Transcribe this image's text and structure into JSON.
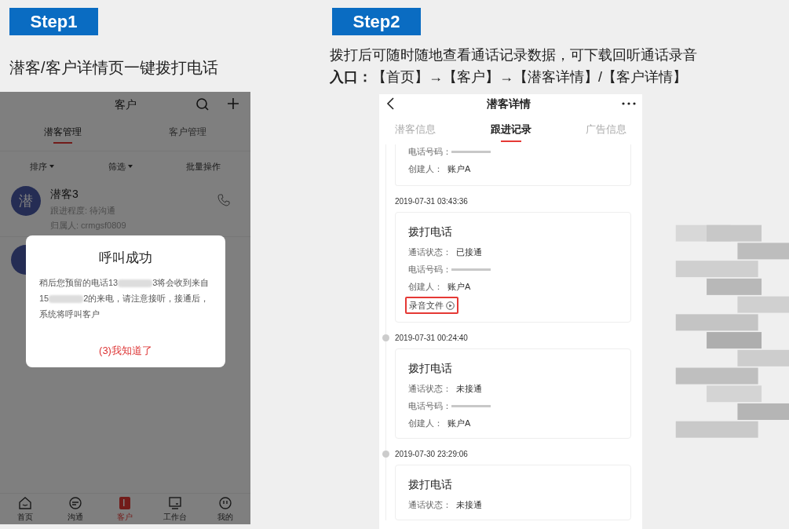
{
  "step1": {
    "badge": "Step1",
    "caption": "潜客/客户详情页一键拨打电话"
  },
  "step2": {
    "badge": "Step2",
    "caption": "拨打后可随时随地查看通话记录数据，可下载回听通话录音",
    "entry": "**入口：**【首页】→【客户】→【潜客详情】/【客户详情】"
  },
  "customer_screen": {
    "title": "客户",
    "tabs": [
      {
        "label": "潜客管理",
        "selected": true
      },
      {
        "label": "客户管理",
        "selected": false
      }
    ],
    "toolbar": [
      {
        "label": "排序",
        "dropdown": true
      },
      {
        "label": "筛选",
        "dropdown": true
      },
      {
        "label": "批量操作",
        "dropdown": false
      }
    ],
    "items": [
      {
        "avatar": "潜",
        "name": "潜客3",
        "lines": [
          "跟进程度: 待沟通",
          "归属人: crmgsf0809"
        ]
      }
    ],
    "dialog": {
      "title": "呼叫成功",
      "message": [
        "稍后您预留的电话13",
        "3将会收到来自15",
        "2的来电，请注意接听，接通后，系统将呼叫客户"
      ],
      "button": "(3)我知道了"
    },
    "nav": [
      {
        "label": "首页",
        "selected": false
      },
      {
        "label": "沟通",
        "selected": false
      },
      {
        "label": "客户",
        "selected": true
      },
      {
        "label": "工作台",
        "selected": false
      },
      {
        "label": "我的",
        "selected": false
      }
    ]
  },
  "detail_screen": {
    "title": "潜客详情",
    "tabs": [
      {
        "label": "潜客信息",
        "selected": false
      },
      {
        "label": "跟进记录",
        "selected": true
      },
      {
        "label": "广告信息",
        "selected": false
      }
    ],
    "records": [
      {
        "fields": [
          {
            "label": "电话号码："
          },
          {
            "label": "创建人：",
            "value": "账户A"
          }
        ]
      },
      {
        "timestamp": "2019-07-31 03:43:36",
        "dot": false,
        "title": "拨打电话",
        "fields": [
          {
            "label": "通话状态：",
            "value": "已接通"
          },
          {
            "label": "电话号码："
          },
          {
            "label": "创建人：",
            "value": "账户A"
          }
        ],
        "recording": "录音文件"
      },
      {
        "timestamp": "2019-07-31 00:24:40",
        "dot": true,
        "title": "拨打电话",
        "fields": [
          {
            "label": "通话状态：",
            "value": "未接通"
          },
          {
            "label": "电话号码："
          },
          {
            "label": "创建人：",
            "value": "账户A"
          }
        ]
      },
      {
        "timestamp": "2019-07-30 23:29:06",
        "dot": true,
        "title": "拨打电话",
        "fields": [
          {
            "label": "通话状态：",
            "value": "未接通"
          }
        ]
      }
    ]
  }
}
